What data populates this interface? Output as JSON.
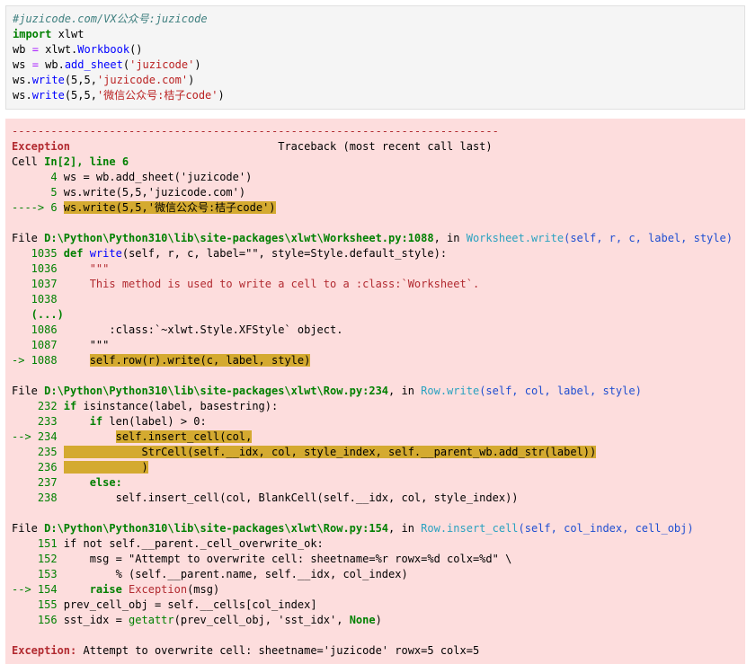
{
  "input": {
    "comment": "#juzicode.com/VX公众号:juzicode",
    "l2_kw": "import",
    "l2_rest": " xlwt",
    "l3_a": "wb ",
    "l3_eq": "=",
    "l3_b": " xlwt.",
    "l3_fn": "Workbook",
    "l3_c": "()",
    "l4_a": "ws ",
    "l4_eq": "=",
    "l4_b": " wb.",
    "l4_fn": "add_sheet",
    "l4_c": "(",
    "l4_str": "'juzicode'",
    "l4_d": ")",
    "l5_a": "ws.",
    "l5_fn": "write",
    "l5_b": "(5,5,",
    "l5_str": "'juzicode.com'",
    "l5_c": ")",
    "l6_a": "ws.",
    "l6_fn": "write",
    "l6_b": "(5,5,",
    "l6_str": "'微信公众号:桔子code'",
    "l6_c": ")"
  },
  "output": {
    "dashes": "---------------------------------------------------------------------------",
    "exception_label": "Exception",
    "traceback_label": "Traceback (most recent call last)",
    "cell_a": "Cell ",
    "cell_b": "In[2], line 6",
    "f1": {
      "l4_no": "      4 ",
      "l4_code": "ws = wb.add_sheet('juzicode')",
      "l5_no": "      5 ",
      "l5_code": "ws.write(5,5,'juzicode.com')",
      "arrow": "----> 6 ",
      "l6_code": "ws.write(5,5,'微信公众号:桔子code')"
    },
    "f2": {
      "file_label": "File ",
      "path": "D:\\Python\\Python310\\lib\\site-packages\\xlwt\\Worksheet.py:1088",
      "in_label": ", in ",
      "func": "Worksheet.write",
      "args": "(self, r, c, label, style)",
      "n1035": "   1035 ",
      "def_kw": "def",
      "def_fn": "write",
      "def_rest": "(self, r, c, label=\"\", style=Style.default_style):",
      "n1036": "   1036 ",
      "c1036": "    \"\"\"",
      "n1037": "   1037 ",
      "c1037": "    This method is used to write a cell to a :class:`Worksheet`.",
      "n1038": "   1038 ",
      "ellipsis": "   (...)",
      "n1086": "   1086 ",
      "c1086": "       :class:`~xlwt.Style.XFStyle` object.",
      "n1087": "   1087 ",
      "c1087": "    \"\"\"",
      "arrow": "-> 1088 ",
      "c1088": "self.row(r).write(c, label, style)"
    },
    "f3": {
      "file_label": "File ",
      "path": "D:\\Python\\Python310\\lib\\site-packages\\xlwt\\Row.py:234",
      "in_label": ", in ",
      "func": "Row.write",
      "args": "(self, col, label, style)",
      "n232": "    232 ",
      "c232_kw": "if",
      "c232_fn": " isinstance",
      "c232_rest": "(label, basestring):",
      "n233": "    233 ",
      "c233_kw": "    if",
      "c233_fn": " len",
      "c233_rest": "(label) > 0:",
      "arrow234": "--> 234 ",
      "c234_pre": "        ",
      "c234": "self.insert_cell(col,",
      "n235": "    235 ",
      "c235": "            StrCell(self.__idx, col, style_index, self.__parent_wb.add_str(label))",
      "n236": "    236 ",
      "c236": "            )",
      "n237": "    237 ",
      "c237": "    else:",
      "n238": "    238 ",
      "c238": "        self.insert_cell(col, BlankCell(self.__idx, col, style_index))"
    },
    "f4": {
      "file_label": "File ",
      "path": "D:\\Python\\Python310\\lib\\site-packages\\xlwt\\Row.py:154",
      "in_label": ", in ",
      "func": "Row.insert_cell",
      "args": "(self, col_index, cell_obj)",
      "n151": "    151 ",
      "c151": "if not self.__parent._cell_overwrite_ok:",
      "n152": "    152 ",
      "c152": "    msg = \"Attempt to overwrite cell: sheetname=%r rowx=%d colx=%d\" \\",
      "n153": "    153 ",
      "c153": "        % (self.__parent.name, self.__idx, col_index)",
      "arrow154": "--> 154 ",
      "c154_kw": "    raise ",
      "c154_exc": "Exception",
      "c154_rest": "(msg)",
      "n155": "    155 ",
      "c155": "prev_cell_obj = self.__cells[col_index]",
      "n156": "    156 ",
      "c156_a": "sst_idx = ",
      "c156_fn": "getattr",
      "c156_b": "(prev_cell_obj, 'sst_idx', ",
      "c156_kw": "None",
      "c156_c": ")"
    },
    "final_label": "Exception:",
    "final_msg": " Attempt to overwrite cell: sheetname='juzicode' rowx=5 colx=5"
  }
}
